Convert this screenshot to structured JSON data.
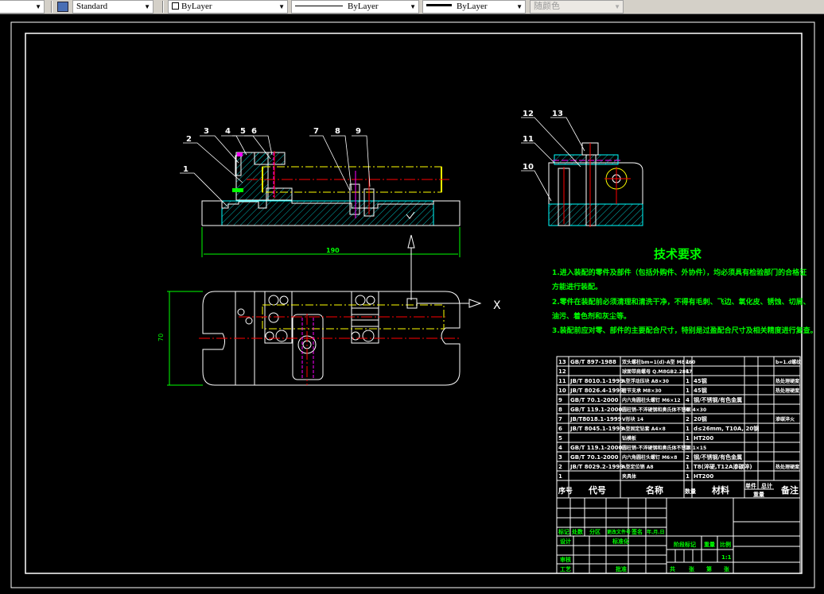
{
  "toolbar": {
    "textstyle": "Standard",
    "layer": "ByLayer",
    "linetype": "ByLayer",
    "lineweight": "ByLayer",
    "plotstyle": "随颜色"
  },
  "drawing": {
    "front_view_balloons": [
      "1",
      "2",
      "3",
      "4",
      "5",
      "6",
      "7",
      "8",
      "9"
    ],
    "side_view_balloons": [
      "12",
      "13",
      "11",
      "10"
    ],
    "dim_length": "190",
    "dim_width": "70",
    "axis_label": "X",
    "colors": {
      "outline": "#ffffff",
      "hatch": "#00ffff",
      "center": "#ff0000",
      "hidden": "#ff00ff",
      "workpiece": "#ffff00",
      "dimension": "#00ff00",
      "text": "#00ff00"
    }
  },
  "tech": {
    "title": "技术要求",
    "lines": [
      "1.进入装配的零件及部件（包括外购件、外协件），均必须具有检验部门的合格证",
      "方能进行装配。",
      "2.零件在装配前必须清理和清洗干净，不得有毛刺、飞边、氧化皮、锈蚀、切屑、",
      "油污、着色剂和灰尘等。",
      "3.装配前应对零、部件的主要配合尺寸，特别是过盈配合尺寸及相关精度进行复查。"
    ]
  },
  "bom": {
    "headers": {
      "seq": "序号",
      "code": "代号",
      "name": "名称",
      "qty": "数量",
      "material": "材料",
      "single": "单件",
      "total": "总计",
      "weight": "重量",
      "notes": "备注"
    },
    "rows": [
      {
        "seq": "13",
        "code": "GB/T 897-1988",
        "name": "双头螺柱bm=1(d)-A型 M8×60",
        "qty": "1",
        "material": "",
        "notes": "b=1.d螺纹"
      },
      {
        "seq": "12",
        "code": "",
        "name": "球面带肩螺母 Q.M8GB2.2867",
        "qty": "1",
        "material": "",
        "notes": ""
      },
      {
        "seq": "11",
        "code": "JB/T 8010.1-1999",
        "name": "A型浮动压块 A8×30",
        "qty": "1",
        "material": "45钢",
        "notes": "热处理硬度"
      },
      {
        "seq": "10",
        "code": "JB/T 8026.4-1999",
        "name": "管节支承 M8×30",
        "qty": "1",
        "material": "45钢",
        "notes": "热处理硬度"
      },
      {
        "seq": "9",
        "code": "GB/T 70.1-2000",
        "name": "内六角圆柱头螺钉 M6×12",
        "qty": "4",
        "material": "钢/不锈钢/有色金属",
        "notes": ""
      },
      {
        "seq": "8",
        "code": "GB/T 119.1-2000",
        "name": "圆柱销-不淬硬钢和奥氏体不锈钢 4×30",
        "qty": "4",
        "material": "",
        "notes": ""
      },
      {
        "seq": "7",
        "code": "JB/T8018.1-1999",
        "name": "V形块 14",
        "qty": "2",
        "material": "20钢",
        "notes": "渗碳淬火"
      },
      {
        "seq": "6",
        "code": "JB/T 8045.1-1999",
        "name": "A型固定钻套 A4×8",
        "qty": "1",
        "material": "d≤26mm, T10A, 20钢",
        "notes": ""
      },
      {
        "seq": "5",
        "code": "",
        "name": "钻模板",
        "qty": "1",
        "material": "HT200",
        "notes": ""
      },
      {
        "seq": "4",
        "code": "GB/T 119.1-2000",
        "name": "圆柱销-不淬硬钢和奥氏体不锈钢 1×15",
        "qty": "2",
        "material": "",
        "notes": ""
      },
      {
        "seq": "3",
        "code": "GB/T 70.1-2000",
        "name": "内六角圆柱头螺钉 M6×8",
        "qty": "2",
        "material": "钢/不锈钢/有色金属",
        "notes": ""
      },
      {
        "seq": "2",
        "code": "JB/T 8029.2-1999",
        "name": "A型定位销 A8",
        "qty": "1",
        "material": "T8(淬硬,T12A渗碳淬)",
        "notes": "热处理硬度"
      },
      {
        "seq": "1",
        "code": "",
        "name": "夹具体",
        "qty": "1",
        "material": "HT200",
        "notes": ""
      }
    ]
  },
  "title_block": {
    "mark": "标记",
    "count": "处数",
    "zone": "分区",
    "change_doc": "更改文件号",
    "sign": "签名",
    "date": "年.月.日",
    "design": "设计",
    "standard": "标准化",
    "review": "审核",
    "process": "工艺",
    "approve": "批准",
    "stage": "阶段标记",
    "weight": "重量",
    "scale": "比例",
    "scale_value": "1:1",
    "total": "共",
    "sheet": "张",
    "nth": "第",
    "sheet2": "张"
  }
}
